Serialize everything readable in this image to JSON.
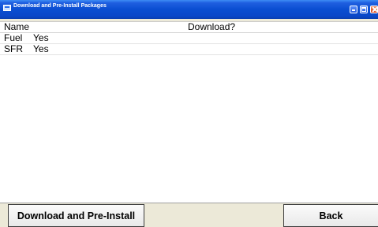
{
  "window": {
    "title": "Download and Pre-Install Packages",
    "app_icon": "window-app-icon",
    "controls": [
      "minimize-icon",
      "maximize-icon",
      "close-icon"
    ]
  },
  "list": {
    "columns": [
      "Name",
      "Download?"
    ],
    "rows": [
      {
        "name": "Fuel",
        "download": "Yes"
      },
      {
        "name": "SFR",
        "download": "Yes"
      }
    ]
  },
  "buttons": {
    "install": "Download and Pre-Install",
    "back": "Back"
  }
}
